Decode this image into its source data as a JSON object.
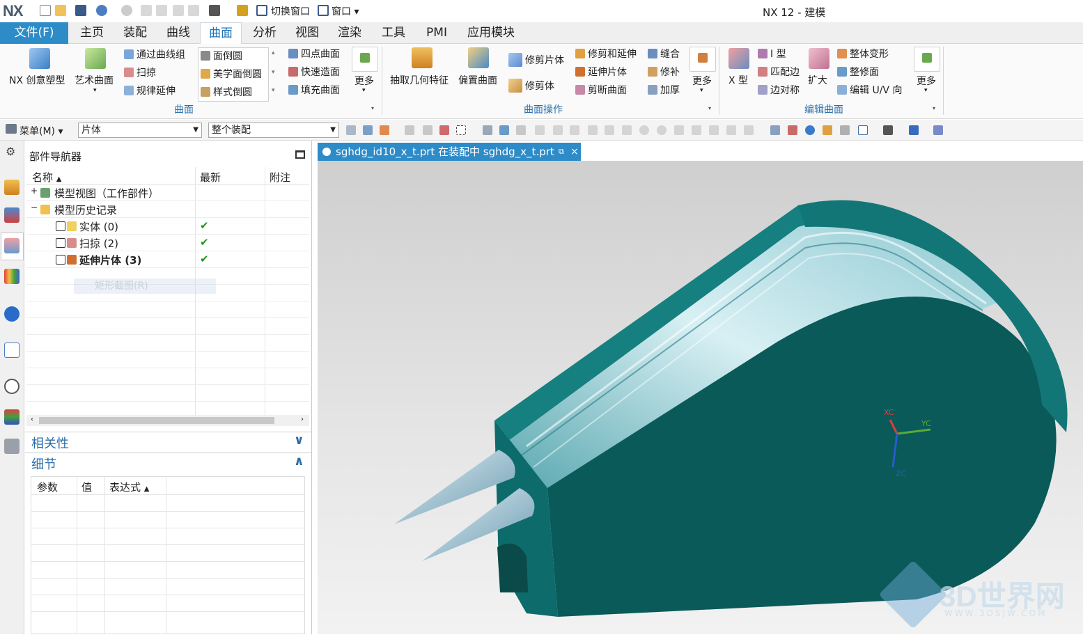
{
  "window": {
    "logo": "NX",
    "title": "NX 12 - 建模",
    "switch_window": "切换窗口",
    "window_menu": "窗口"
  },
  "tabs": {
    "file": "文件(F)",
    "items": [
      "主页",
      "装配",
      "曲线",
      "曲面",
      "分析",
      "视图",
      "渲染",
      "工具",
      "PMI",
      "应用模块"
    ],
    "active": "曲面"
  },
  "ribbon": {
    "surface_group": {
      "label": "曲面",
      "big": [
        "NX 创意塑型",
        "艺术曲面"
      ],
      "col1": [
        "通过曲线组",
        "扫掠",
        "规律延伸"
      ],
      "col2": [
        "面倒圆",
        "美学面倒圆",
        "样式倒圆"
      ],
      "col3": [
        "四点曲面",
        "快速造面",
        "填充曲面"
      ],
      "more": "更多"
    },
    "surface_ops_group": {
      "label": "曲面操作",
      "big": [
        "抽取几何特征",
        "偏置曲面"
      ],
      "col1": [
        "修剪片体",
        "修剪体"
      ],
      "col2": [
        "修剪和延伸",
        "延伸片体",
        "剪断曲面"
      ],
      "col3": [
        "缝合",
        "修补",
        "加厚"
      ],
      "more": "更多"
    },
    "edit_group": {
      "label": "编辑曲面",
      "big": [
        "X 型",
        "扩大"
      ],
      "col1": [
        "I 型",
        "匹配边",
        "边对称"
      ],
      "col2": [
        "整体变形",
        "整修面",
        "编辑 U/V 向"
      ],
      "more": "更多"
    }
  },
  "toolbar2": {
    "menu": "菜单(M)",
    "filter": "片体",
    "scope": "整个装配"
  },
  "navigator": {
    "title": "部件导航器",
    "columns": [
      "名称",
      "最新",
      "附注"
    ],
    "rows": [
      {
        "label": "模型视图（工作部件）",
        "latest": "",
        "expander": "+"
      },
      {
        "label": "模型历史记录",
        "latest": "",
        "expander": "−"
      },
      {
        "label": "实体 (0)",
        "latest": "✔"
      },
      {
        "label": "扫掠 (2)",
        "latest": "✔"
      },
      {
        "label": "延伸片体 (3)",
        "latest": "✔",
        "bold": true
      }
    ],
    "ghost": "矩形截图(R)",
    "dependencies": "相关性",
    "details": "细节",
    "detail_columns": [
      "参数",
      "值",
      "表达式"
    ]
  },
  "viewport": {
    "tab_title": "sghdg_id10_x_t.prt 在装配中 sghdg_x_t.prt",
    "axes": {
      "x": "XC",
      "y": "YC",
      "z": "ZC"
    },
    "watermark": "3D世界网",
    "watermark_sub": "WWW.3DSJW.COM"
  },
  "colors": {
    "accent": "#2d8bc8",
    "model": "#0d6b6b",
    "model_dark": "#0a5252",
    "model_light": "#1a8080"
  }
}
